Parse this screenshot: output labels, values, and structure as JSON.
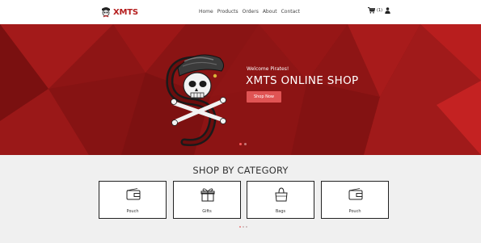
{
  "brand": {
    "name": "XMTS"
  },
  "nav": {
    "links": [
      "Home",
      "Products",
      "Orders",
      "About",
      "Contact"
    ]
  },
  "header": {
    "cart_count": "(1)"
  },
  "hero": {
    "welcome": "Welcome Pirates!",
    "title": "XMTS ONLINE SHOP",
    "cta_label": "Shop Now",
    "slide_count": 2,
    "active_slide": 0
  },
  "categories": {
    "heading": "SHOP BY CATEGORY",
    "items": [
      {
        "label": "Pouch",
        "icon": "wallet-icon"
      },
      {
        "label": "Gifts",
        "icon": "gift-icon"
      },
      {
        "label": "Bags",
        "icon": "handbag-icon"
      },
      {
        "label": "Pouch",
        "icon": "wallet-icon"
      }
    ],
    "page_count": 3,
    "active_page": 0
  },
  "colors": {
    "brand": "#b41c1c",
    "hero": "#8e1515",
    "cta": "#e05454",
    "section_bg": "#f0f0f0"
  }
}
